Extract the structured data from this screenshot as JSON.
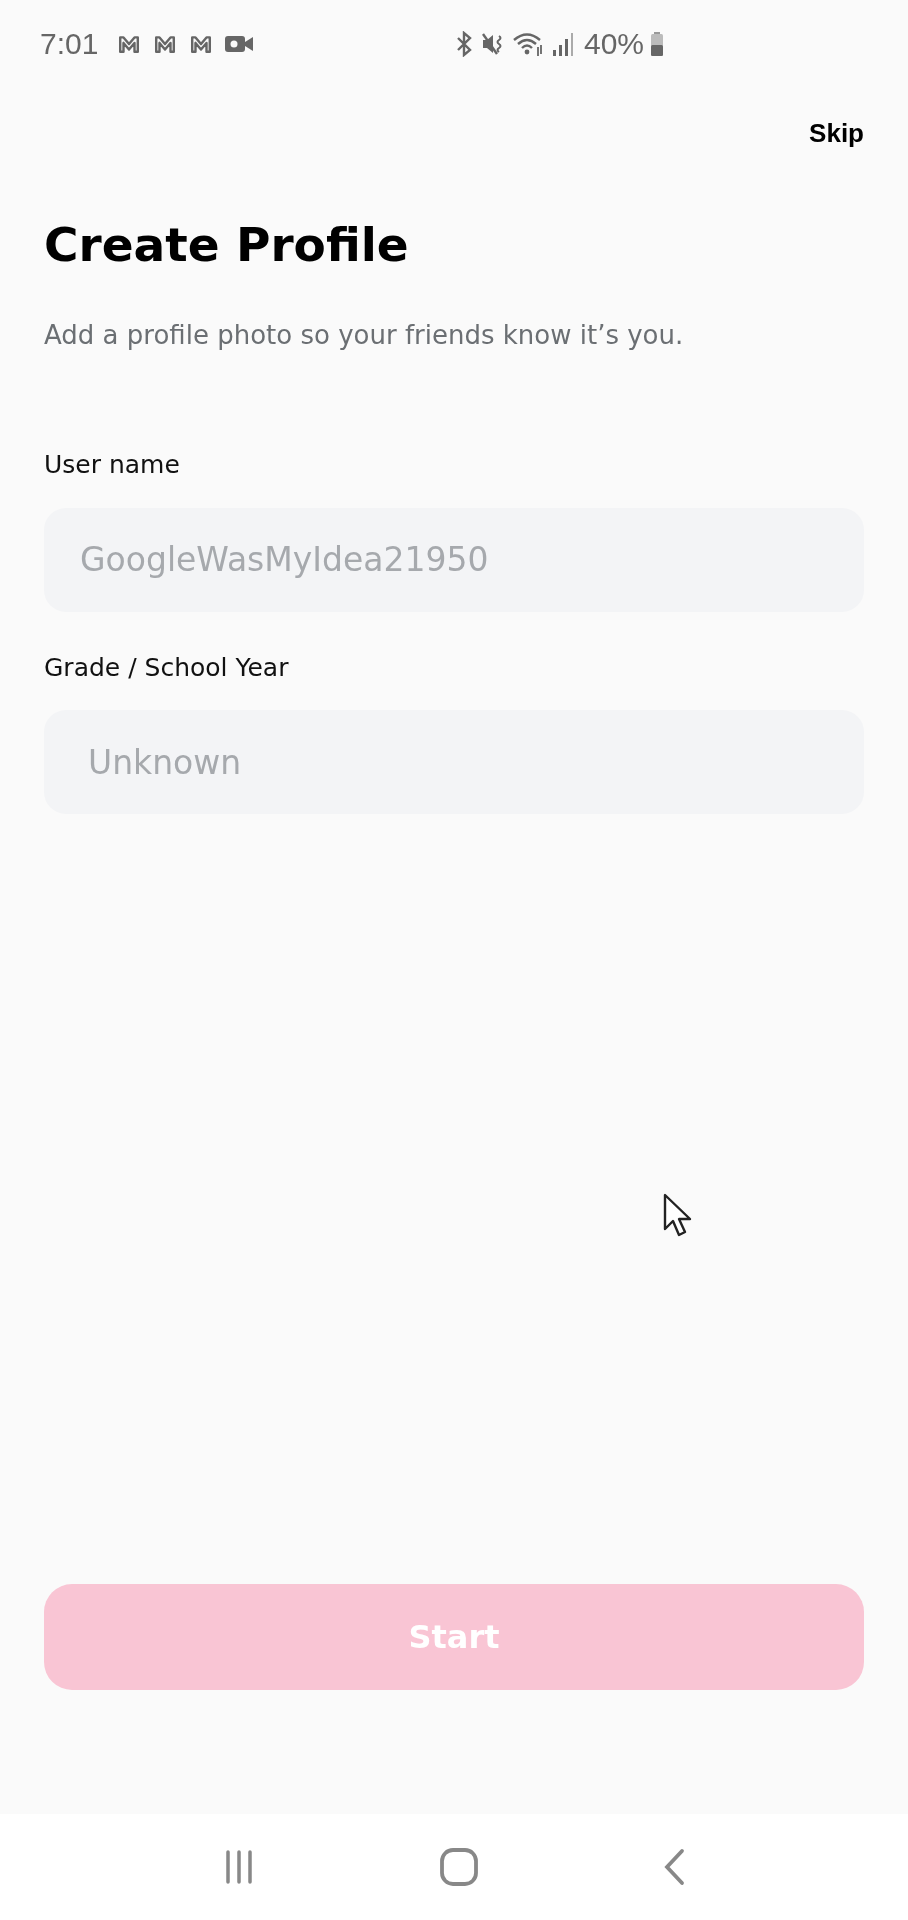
{
  "status_bar": {
    "time": "7:01",
    "battery_text": "40%"
  },
  "header": {
    "skip": "Skip"
  },
  "title": "Create Profile",
  "subtitle": "Add a profile photo so your friends know it’s you.",
  "fields": [
    {
      "label": "User name",
      "placeholder": "GoogleWasMyIdea21950",
      "kind": "text"
    },
    {
      "label": "Grade / School Year",
      "placeholder": "Unknown",
      "kind": "select"
    }
  ],
  "start_button": {
    "label": "Start",
    "disabled": true
  }
}
